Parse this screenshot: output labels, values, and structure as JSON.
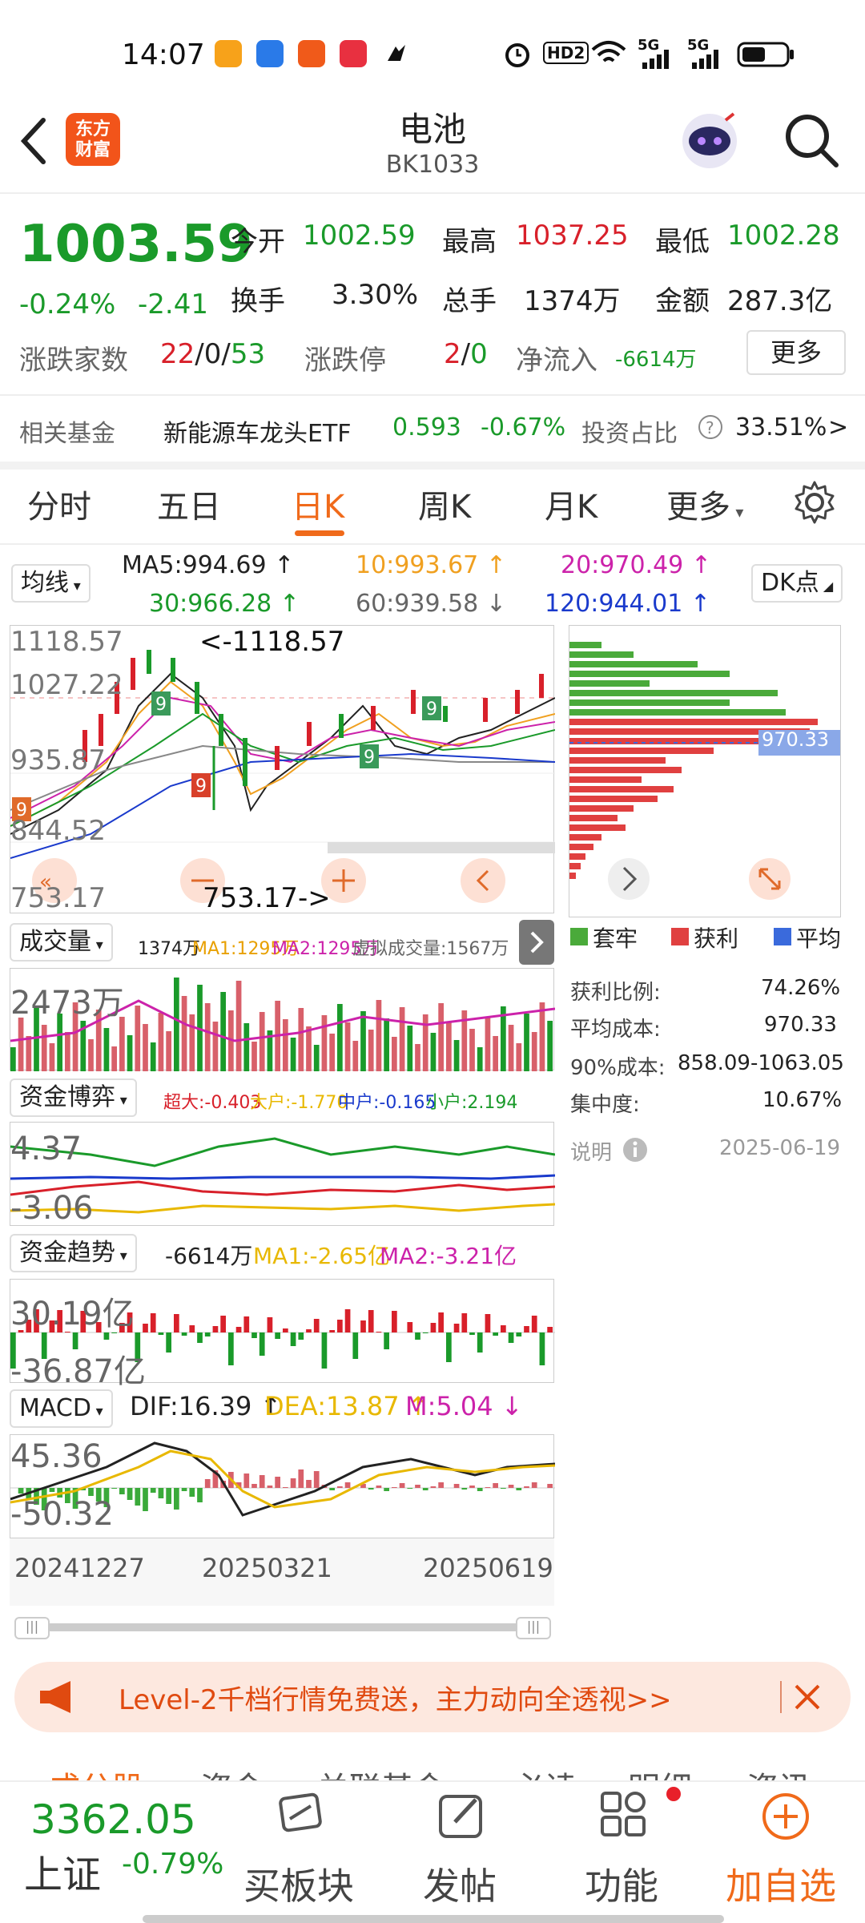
{
  "status": {
    "time": "14:07",
    "signal": "5G",
    "hd": "HD2"
  },
  "header": {
    "title": "电池",
    "code": "BK1033",
    "logo_text": "东方财富"
  },
  "quote": {
    "price": "1003.59",
    "change_pct": "-0.24%",
    "change_abs": "-2.41",
    "open_label": "今开",
    "open": "1002.59",
    "high_label": "最高",
    "high": "1037.25",
    "low_label": "最低",
    "low": "1002.28",
    "turnover_label": "换手",
    "turnover": "3.30%",
    "volume_label": "总手",
    "volume": "1374万",
    "amount_label": "金额",
    "amount": "287.3亿",
    "updown_label": "涨跌家数",
    "up": "22",
    "sep1": "/",
    "flat": "0",
    "sep2": "/",
    "down": "53",
    "limit_label": "涨跌停",
    "limit_up": "2",
    "sep3": "/",
    "limit_down": "0",
    "inflow_label": "净流入",
    "inflow": "-6614万",
    "more": "更多"
  },
  "fund": {
    "label": "相关基金",
    "name": "新能源车龙头ETF",
    "price": "0.593",
    "change": "-0.67%",
    "ratio_label": "投资占比",
    "ratio": "33.51%",
    "arrow": ">"
  },
  "tabs": [
    "分时",
    "五日",
    "日K",
    "周K",
    "月K",
    "更多"
  ],
  "ma": {
    "selector": "均线",
    "ma5": "MA5:994.69",
    "ma5_arrow": "↑",
    "ma10": "10:993.67",
    "ma10_arrow": "↑",
    "ma20": "20:970.49",
    "ma20_arrow": "↑",
    "ma30": "30:966.28",
    "ma30_arrow": "↑",
    "ma60": "60:939.58",
    "ma60_arrow": "↓",
    "ma120": "120:944.01",
    "ma120_arrow": "↑",
    "dk": "DK点"
  },
  "kline": {
    "y_labels": [
      "1118.57",
      "1027.22",
      "935.87",
      "844.52",
      "753.17"
    ],
    "max_mark": "<-1118.57",
    "min_mark": "753.17->"
  },
  "chips": {
    "price_tag": "970.33",
    "legend": [
      "套牢",
      "获利",
      "平均"
    ],
    "profit_label": "获利比例:",
    "profit": "74.26%",
    "avgcost_label": "平均成本:",
    "avgcost": "970.33",
    "cost90_label": "90%成本:",
    "cost90": "858.09-1063.05",
    "concentration_label": "集中度:",
    "concentration": "10.67%",
    "note_label": "说明",
    "date": "2025-06-19"
  },
  "volume": {
    "selector": "成交量",
    "info": "1374万",
    "ma1": "MA1:1295万",
    "ma2": "MA2:1295万",
    "virtual": "虚拟成交量:1567万",
    "y_top": "2473万"
  },
  "capital_game": {
    "selector": "资金博弈",
    "super": "超大:-0.403",
    "big": "大户:-1.770",
    "mid": "中户:-0.165",
    "small": "小户:2.194",
    "y_top": "4.37",
    "y_bottom": "-3.06"
  },
  "capital_trend": {
    "selector": "资金趋势",
    "value": "-6614万",
    "ma1": "MA1:-2.65亿",
    "ma2": "MA2:-3.21亿",
    "y_top": "30.19亿",
    "y_bottom": "-36.87亿"
  },
  "macd": {
    "selector": "MACD",
    "dif": "DIF:16.39",
    "dea": "DEA:13.87",
    "m": "M:5.04",
    "y_top": "45.36",
    "y_bottom": "-50.32",
    "dates": [
      "20241227",
      "20250321",
      "20250619"
    ]
  },
  "banner": {
    "text": "Level-2千档行情免费送，主力动向全透视>>"
  },
  "subtabs": [
    "成分股",
    "资金",
    "关联基金",
    "必读",
    "明细",
    "资讯"
  ],
  "bottom": {
    "index_value": "3362.05",
    "index_name": "上证",
    "index_change": "-0.79%",
    "buy": "买板块",
    "post": "发帖",
    "func": "功能",
    "add": "加自选"
  },
  "colors": {
    "accent": "#f06a1a",
    "up": "#d8202a",
    "down": "#1a9a2a"
  }
}
